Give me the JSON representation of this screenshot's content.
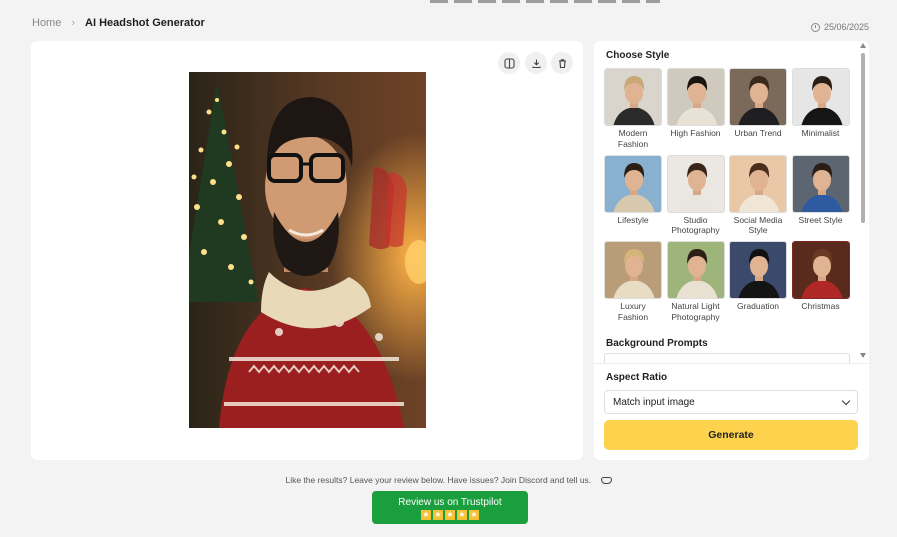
{
  "breadcrumb": {
    "home": "Home",
    "separator": "›",
    "current": "AI Headshot Generator"
  },
  "date": "25/06/2025",
  "preview": {
    "tools": [
      "compare-icon",
      "download-icon",
      "trash-icon"
    ]
  },
  "panel": {
    "choose_style_title": "Choose Style",
    "styles": [
      {
        "label": "Modern Fashion",
        "bg": "#d9d4cc",
        "hair": "#c9a878",
        "cloth": "#2b2b2b",
        "selected": false
      },
      {
        "label": "High Fashion",
        "bg": "#cfc9be",
        "hair": "#1a1410",
        "cloth": "#e8e2d6",
        "selected": false
      },
      {
        "label": "Urban Trend",
        "bg": "#7b6a5a",
        "hair": "#3a2a1e",
        "cloth": "#1f1f22",
        "selected": false
      },
      {
        "label": "Minimalist",
        "bg": "#e6e6e6",
        "hair": "#2a1d15",
        "cloth": "#161616",
        "selected": false
      },
      {
        "label": "Lifestyle",
        "bg": "#8ab0cf",
        "hair": "#2c1e14",
        "cloth": "#d8c9ae",
        "selected": false
      },
      {
        "label": "Studio Photography",
        "bg": "#ebe7e2",
        "hair": "#3a2519",
        "cloth": "#e9e5df",
        "selected": false
      },
      {
        "label": "Social Media Style",
        "bg": "#e9c8a8",
        "hair": "#4a2d1d",
        "cloth": "#efe6d6",
        "selected": false
      },
      {
        "label": "Street Style",
        "bg": "#5d6670",
        "hair": "#2a1e16",
        "cloth": "#2d5aa0",
        "selected": false
      },
      {
        "label": "Luxury Fashion",
        "bg": "#b89d78",
        "hair": "#d3b47a",
        "cloth": "#e8dcc4",
        "selected": false
      },
      {
        "label": "Natural Light Photography",
        "bg": "#9db57a",
        "hair": "#2e1f15",
        "cloth": "#e9e2d2",
        "selected": false
      },
      {
        "label": "Graduation",
        "bg": "#3b4a6a",
        "hair": "#111111",
        "cloth": "#141414",
        "selected": false
      },
      {
        "label": "Christmas",
        "bg": "#5a2a1c",
        "hair": "#6b3a22",
        "cloth": "#b02727",
        "selected": true
      }
    ],
    "background_prompts_title": "Background Prompts",
    "aspect_ratio_title": "Aspect Ratio",
    "aspect_ratio_value": "Match input image",
    "generate_label": "Generate"
  },
  "footer": {
    "feedback_text": "Like the results? Leave your review below. Have issues? Join Discord and tell us.",
    "trustpilot_label": "Review us on Trustpilot",
    "trustpilot_stars": 5
  },
  "colors": {
    "accent": "#fdd34d",
    "trustpilot": "#1b9e3e"
  }
}
